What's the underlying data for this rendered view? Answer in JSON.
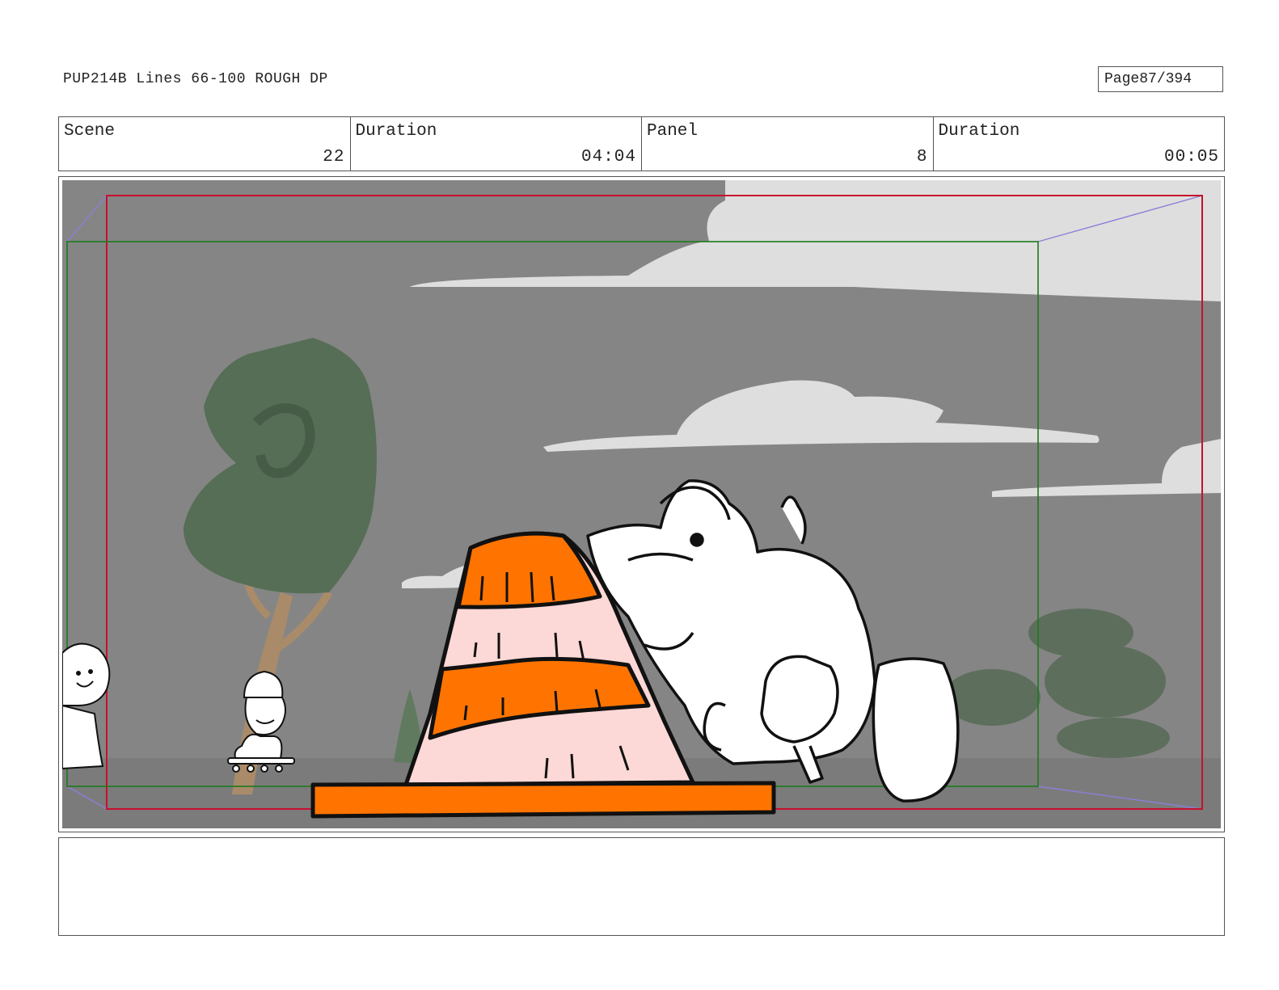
{
  "header": {
    "title": "PUP214B Lines 66-100 ROUGH DP",
    "page_label": "Page",
    "page_number": "87/394"
  },
  "info": {
    "scene_label": "Scene",
    "scene_value": "22",
    "scene_duration_label": "Duration",
    "scene_duration_value": "04:04",
    "panel_label": "Panel",
    "panel_value": "8",
    "panel_duration_label": "Duration",
    "panel_duration_value": "00:05"
  },
  "notes": {
    "text": ""
  },
  "colors": {
    "sky": "#858585",
    "clouds": "#dedede",
    "cone_orange": "#ff7400",
    "cone_pink": "#fcd8d6",
    "tree_green": "#556e55",
    "red_frame": "#c8102e",
    "green_frame": "#1b7a1b",
    "camera_lines": "#8a80d8"
  },
  "icons": [
    "storyboard-panel-drawing",
    "traffic-cone",
    "puppy-character",
    "tree",
    "cloud"
  ]
}
